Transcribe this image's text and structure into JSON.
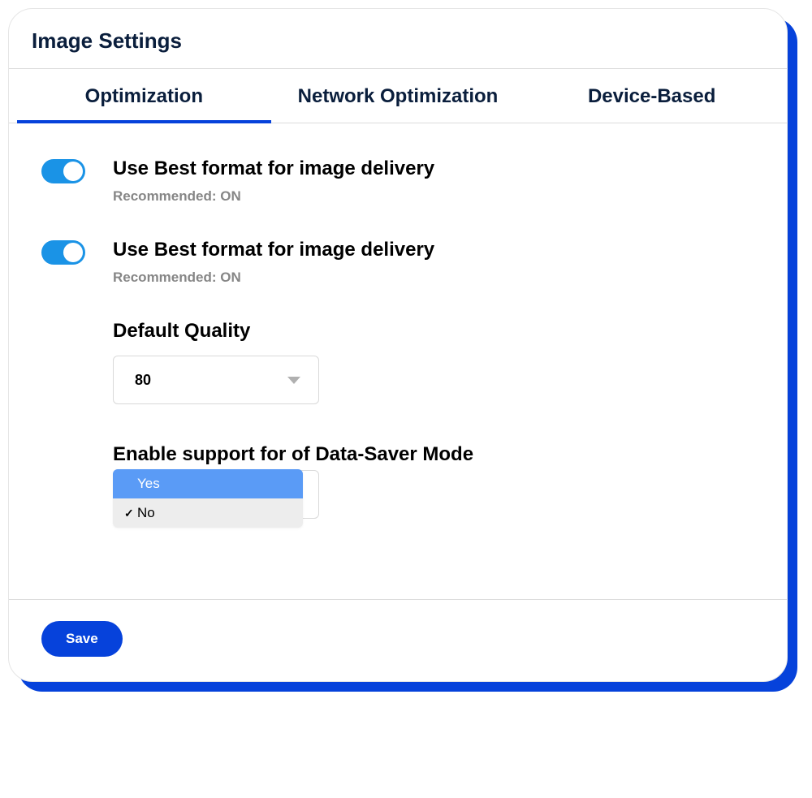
{
  "title": "Image Settings",
  "tabs": [
    {
      "label": "Optimization",
      "active": true
    },
    {
      "label": "Network Optimization",
      "active": false
    },
    {
      "label": "Device-Based",
      "active": false
    }
  ],
  "settings": {
    "toggle1": {
      "label": "Use Best format for image delivery",
      "hint": "Recommended: ON",
      "on": true
    },
    "toggle2": {
      "label": "Use Best format for image delivery",
      "hint": "Recommended: ON",
      "on": true
    },
    "default_quality": {
      "label": "Default Quality",
      "value": "80"
    },
    "data_saver": {
      "label": "Enable support for of Data-Saver Mode",
      "options": [
        {
          "label": "Yes",
          "highlighted": true,
          "checked": false
        },
        {
          "label": "No",
          "highlighted": false,
          "checked": true
        }
      ]
    }
  },
  "footer": {
    "save_label": "Save"
  }
}
